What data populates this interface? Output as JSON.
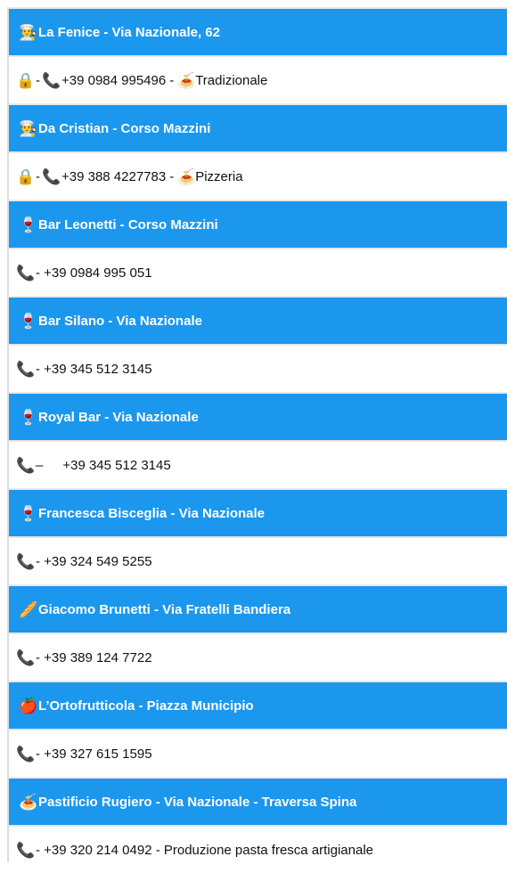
{
  "entries": [
    {
      "header_icon": "chef-icon",
      "header_glyph": "👨‍🍳",
      "title": "La Fenice - Via Nazionale, 62",
      "detail_prefix_icon": "lock-icon",
      "phone": "+39 0984 995496",
      "category_icon": "pasta-bowl-icon",
      "category": "Tradizionale"
    },
    {
      "header_icon": "chef-icon",
      "header_glyph": "👨‍🍳",
      "title": "Da Cristian - Corso Mazzini",
      "detail_prefix_icon": "lock-icon",
      "phone": "+39 388 4227783",
      "category_icon": "pasta-bowl-icon",
      "category": "Pizzeria"
    },
    {
      "header_icon": "wine-glass-icon",
      "header_glyph": "🍷",
      "title": "Bar  Leonetti - Corso Mazzini",
      "phone": "- +39 0984 995 051"
    },
    {
      "header_icon": "wine-glass-icon",
      "header_glyph": "🍷",
      "title": "Bar Silano - Via Nazionale",
      "phone": "- +39 345 512 3145"
    },
    {
      "header_icon": "wine-glass-icon",
      "header_glyph": "🍷",
      "title": "Royal Bar - Via Nazionale",
      "phone": "+39 345 512 3145"
    },
    {
      "header_icon": "wine-glass-icon",
      "header_glyph": "🍷",
      "title": "Francesca Bisceglia - Via Nazionale",
      "phone": "- +39 324 549 5255"
    },
    {
      "header_icon": "bread-icon",
      "header_glyph": "🥖",
      "title": "Giacomo Brunetti - Via Fratelli Bandiera",
      "phone": "- +39 389 124 7722"
    },
    {
      "header_icon": "apple-icon",
      "header_glyph": "🍎",
      "title": "L’Ortofrutticola - Piazza Municipio",
      "phone": "- +39 327 615 1595"
    },
    {
      "header_icon": "pasta-bowl-icon",
      "header_glyph": "🍝",
      "title": "Pastificio Rugiero - Via Nazionale - Traversa Spina",
      "phone": "- +39 320 214 0492 - Produzione pasta fresca artigianale"
    }
  ],
  "colors": {
    "header_bg": "#1b97ee",
    "header_text": "#ffffff",
    "detail_text": "#111111",
    "border": "#dddddd"
  }
}
